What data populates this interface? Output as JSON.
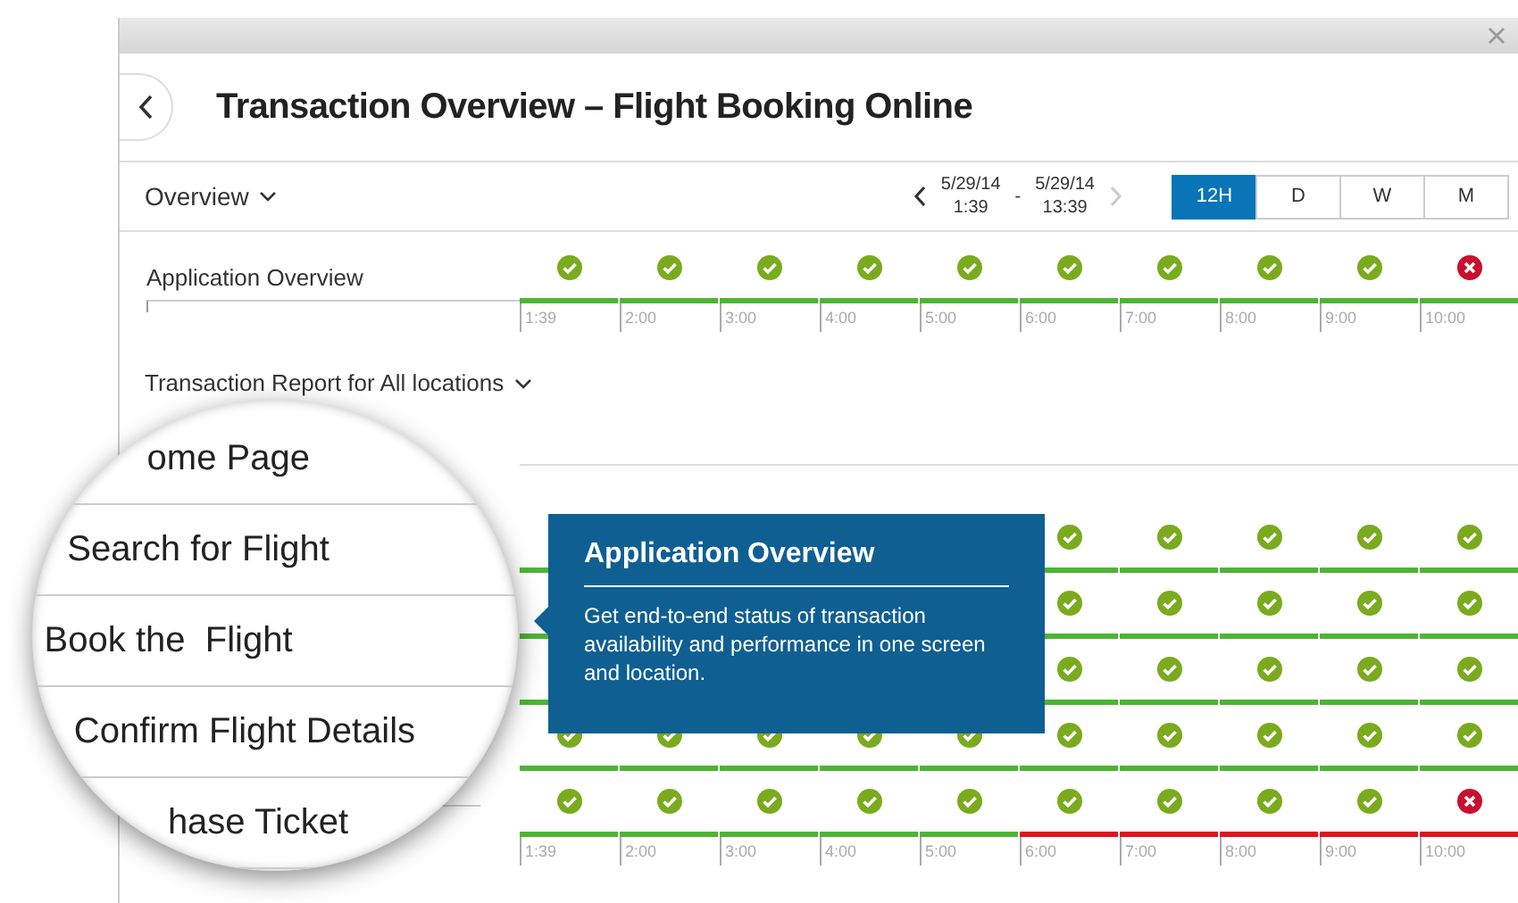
{
  "window": {
    "title": "Transaction Overview – Flight Booking Online"
  },
  "toolbar": {
    "view": "Overview",
    "range_start_date": "5/29/14",
    "range_start_time": "1:39",
    "separator": "-",
    "range_end_date": "5/29/14",
    "range_end_time": "13:39",
    "next_disabled": true,
    "periods": [
      {
        "label": "12H",
        "selected": true
      },
      {
        "label": "D",
        "selected": false
      },
      {
        "label": "W",
        "selected": false
      },
      {
        "label": "M",
        "selected": false
      }
    ]
  },
  "application_overview": {
    "label": "Application Overview",
    "cells": [
      {
        "kind": "ok",
        "bar_red": false
      },
      {
        "kind": "ok",
        "bar_red": false
      },
      {
        "kind": "ok",
        "bar_red": false
      },
      {
        "kind": "ok",
        "bar_red": false
      },
      {
        "kind": "ok",
        "bar_red": false
      },
      {
        "kind": "ok",
        "bar_red": false
      },
      {
        "kind": "ok",
        "bar_red": false
      },
      {
        "kind": "ok",
        "bar_red": false
      },
      {
        "kind": "ok",
        "bar_red": false
      },
      {
        "kind": "failed",
        "bar_red": false
      }
    ],
    "axis_labels": [
      "1:39",
      "2:00",
      "3:00",
      "4:00",
      "5:00",
      "6:00",
      "7:00",
      "8:00",
      "9:00",
      "10:00"
    ]
  },
  "transaction_report": {
    "title": "Transaction Report for All locations",
    "rows": [
      {
        "cells": [
          {
            "kind": "covered",
            "bar_red": false
          },
          {
            "kind": "covered"
          },
          {
            "kind": "covered"
          },
          {
            "kind": "covered"
          },
          {
            "kind": "covered"
          },
          {
            "kind": "ok",
            "bar_red": false
          },
          {
            "kind": "ok",
            "bar_red": false
          },
          {
            "kind": "ok",
            "bar_red": false
          },
          {
            "kind": "ok",
            "bar_red": false
          },
          {
            "kind": "ok",
            "bar_red": false
          }
        ]
      },
      {
        "cells": [
          {
            "kind": "covered",
            "bar_red": false
          },
          {
            "kind": "covered"
          },
          {
            "kind": "covered"
          },
          {
            "kind": "covered"
          },
          {
            "kind": "covered"
          },
          {
            "kind": "ok",
            "bar_red": false
          },
          {
            "kind": "ok",
            "bar_red": false
          },
          {
            "kind": "ok",
            "bar_red": false
          },
          {
            "kind": "ok",
            "bar_red": false
          },
          {
            "kind": "ok",
            "bar_red": false
          }
        ]
      },
      {
        "cells": [
          {
            "kind": "covered",
            "bar_red": false
          },
          {
            "kind": "covered"
          },
          {
            "kind": "covered"
          },
          {
            "kind": "covered"
          },
          {
            "kind": "covered"
          },
          {
            "kind": "ok",
            "bar_red": false
          },
          {
            "kind": "ok",
            "bar_red": false
          },
          {
            "kind": "ok",
            "bar_red": false
          },
          {
            "kind": "ok",
            "bar_red": false
          },
          {
            "kind": "ok",
            "bar_red": false
          }
        ]
      },
      {
        "cells": [
          {
            "kind": "ok",
            "bar_red": false
          },
          {
            "kind": "ok",
            "bar_red": false
          },
          {
            "kind": "ok",
            "bar_red": false
          },
          {
            "kind": "ok",
            "bar_red": false
          },
          {
            "kind": "ok",
            "bar_red": false
          },
          {
            "kind": "ok",
            "bar_red": false
          },
          {
            "kind": "ok",
            "bar_red": false
          },
          {
            "kind": "ok",
            "bar_red": false
          },
          {
            "kind": "ok",
            "bar_red": false
          },
          {
            "kind": "ok",
            "bar_red": false
          }
        ]
      },
      {
        "cells": [
          {
            "kind": "ok",
            "bar_red": false
          },
          {
            "kind": "ok",
            "bar_red": false
          },
          {
            "kind": "ok",
            "bar_red": false
          },
          {
            "kind": "ok",
            "bar_red": false
          },
          {
            "kind": "ok",
            "bar_red": false
          },
          {
            "kind": "ok",
            "bar_red": true
          },
          {
            "kind": "ok",
            "bar_red": true
          },
          {
            "kind": "ok",
            "bar_red": true
          },
          {
            "kind": "ok",
            "bar_red": true
          },
          {
            "kind": "failed",
            "bar_red": true
          }
        ]
      }
    ],
    "axis_labels": [
      "1:39",
      "2:00",
      "3:00",
      "4:00",
      "5:00",
      "6:00",
      "7:00",
      "8:00",
      "9:00",
      "10:00"
    ]
  },
  "magnifier": {
    "labels": [
      "ome Page",
      "Search for Flight",
      "Book the  Flight",
      "Confirm Flight Details",
      "hase Ticket"
    ]
  },
  "tooltip": {
    "title": "Application Overview",
    "text": "Get end-to-end status of transaction availability and performance in one screen and location."
  }
}
